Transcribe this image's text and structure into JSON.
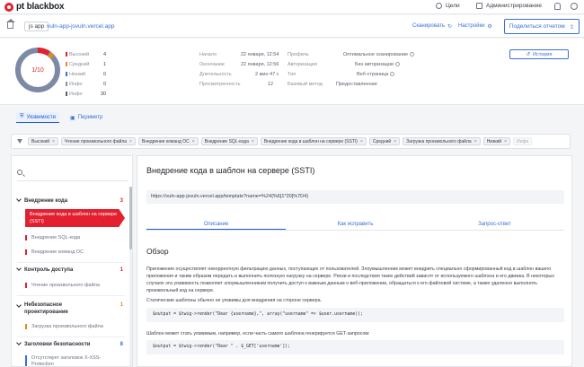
{
  "header": {
    "logo": "pt blackbox",
    "nav_goals": "Цели",
    "nav_admin": "Администрирование"
  },
  "address": {
    "app_tag": "js app",
    "url": "vuln-app-jsvuln.vercel.app",
    "scan_label": "Сканировать",
    "settings_label": "Настройки",
    "share_label": "Поделиться отчетом"
  },
  "summary": {
    "donut_label": "1/10",
    "severity": [
      {
        "label": "Высокий",
        "count": "4",
        "color": "#e3202f"
      },
      {
        "label": "Средний",
        "count": "1",
        "color": "#e38a20"
      },
      {
        "label": "Низкий",
        "count": "0",
        "color": "#3a6fd8"
      },
      {
        "label": "Инфо",
        "count": "0",
        "color": "#8a909b"
      },
      {
        "label": "Инфо",
        "count": "30",
        "color": "#5a606b"
      }
    ],
    "times": [
      {
        "k": "Начало",
        "v": "22 января, 12:54"
      },
      {
        "k": "Окончание",
        "v": "22 января, 12:56"
      },
      {
        "k": "Длительность",
        "v": "2 мин 47 с"
      },
      {
        "k": "Просмотренность",
        "v": "12"
      }
    ],
    "profile": [
      {
        "k": "Профиль",
        "v": "Оптимальное сканирование"
      },
      {
        "k": "Авторизация",
        "v": "Без авторизации"
      },
      {
        "k": "Тип",
        "v": "Веб-страница"
      },
      {
        "k": "Базовый метод",
        "v": "Предоставленная"
      }
    ],
    "history_label": "История"
  },
  "tabs": [
    {
      "label": "Уязвимости",
      "active": true
    },
    {
      "label": "Периметр",
      "active": false
    }
  ],
  "filters": [
    "Высокий",
    "Чтение произвольного файла",
    "Внедрение команд ОС",
    "Внедрение SQL-кода",
    "Внедрение кода в шаблон на сервере (SSTI)",
    "Средний",
    "Загрузка произвольного файла",
    "Низкий",
    "Инфо"
  ],
  "sidebar": {
    "categories": [
      {
        "label": "Внедрение кода",
        "count": "3"
      },
      {
        "label": "Контроль доступа",
        "count": "1"
      },
      {
        "label": "Небезопасное проектирование",
        "count": "1"
      },
      {
        "label": "Заголовки безопасности",
        "count": "8"
      }
    ],
    "items": [
      "Внедрение кода в шаблон на сервере (SSTI)",
      "Внедрение SQL-кода",
      "Внедрение команд ОС",
      "Чтение произвольного файла",
      "Загрузка произвольного файла",
      "Отсутствует заголовок X-XSS-Protection"
    ]
  },
  "detail": {
    "title": "Внедрение кода в шаблон на сервере (SSTI)",
    "url": "https://vuln-app-jsvuln.vercel.app/template?name=%24{%6[1*20]%7D4}",
    "tabs": [
      "Описание",
      "Как исправить",
      "Запрос-ответ"
    ],
    "overview_heading": "Обзор",
    "p1": "Приложение осуществляет некорректную фильтрацию данных, поступающих от пользователей. Злоумышленник может внедрить специально сформированный код в шаблон вашего приложения и таким образом передать и выполнить полезную нагрузку на сервере. Риски и последствия таких действий зависят от используемого шаблона и его движка. В некоторых случаях эта уязвимость позволяет злоумышленникам получить доступ к важным данным о веб-приложении, обращаться к его файловой системе, а также удаленно выполнять произвольный код на сервере.",
    "p2": "Статические шаблоны обычно не уязвимы для внедрения на стороне сервера.",
    "code1": "$output = $twig->render(\"Dear {username},\", array(\"username\" => $user.username));",
    "p3": "Шаблон может стать уязвимым, например, если часть самого шаблона генерируется GET-запросом:",
    "code2": "$output = $twig->render(\"Dear \" . $_GET['username']);"
  }
}
